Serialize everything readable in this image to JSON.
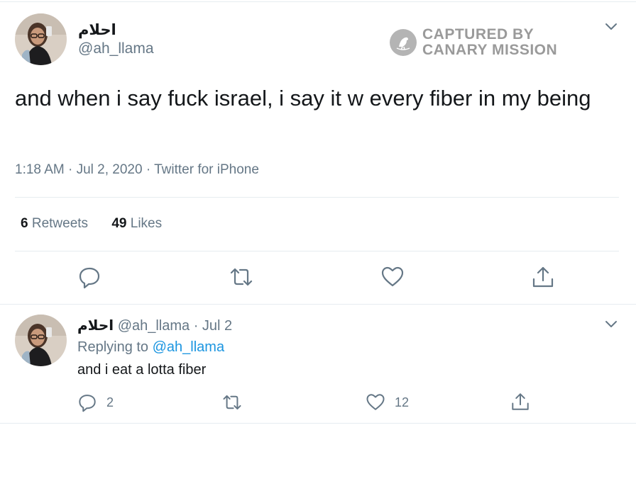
{
  "main_tweet": {
    "display_name": "احلام",
    "handle": "@ah_llama",
    "text": "and when i say fuck israel, i say it w every fiber in my being",
    "meta": "1:18 AM · Jul 2, 2020 · Twitter for iPhone",
    "retweets_count": "6",
    "retweets_label": "Retweets",
    "likes_count": "49",
    "likes_label": "Likes"
  },
  "watermark": {
    "line1": "CAPTURED BY",
    "line2": "CANARY MISSION"
  },
  "reply_tweet": {
    "display_name": "احلام",
    "handle_date": "@ah_llama · Jul 2",
    "replying_prefix": "Replying to",
    "replying_to": "@ah_llama",
    "text": "and i eat a lotta fiber",
    "reply_count": "2",
    "like_count": "12"
  },
  "icons": [
    "chevron-down-icon",
    "reply-icon",
    "retweet-icon",
    "like-icon",
    "share-icon",
    "canary-bird-icon"
  ],
  "colors": {
    "text_primary": "#14171a",
    "text_secondary": "#657786",
    "link": "#1b95e0",
    "divider": "#e6ecf0"
  }
}
